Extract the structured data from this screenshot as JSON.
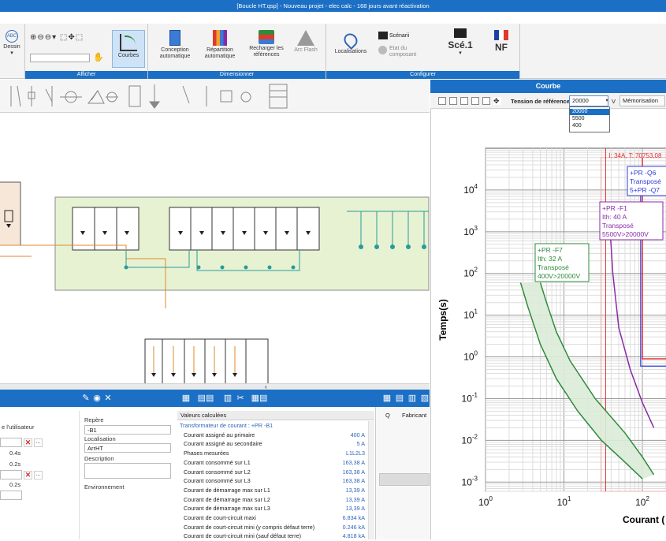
{
  "window": {
    "title": "[Boucle HT.qsp] - Nouveau projet - elec calc - 168 jours avant réactivation"
  },
  "ribbon": {
    "dessin_label": "Dessin",
    "afficher_label": "Afficher",
    "courbes_label": "Courbes",
    "conception_label": "Conception automatique",
    "repartition_label": "Répartition automatique",
    "recharger_label": "Recharger les références",
    "arcflash_label": "Arc Flash",
    "dimensionner_label": "Dimensionner",
    "localisations_label": "Localisations",
    "scenarii_label": "Scénarii",
    "etat_label": "Etat du composant",
    "scenario_value": "Scé.1",
    "norm_value": "NF",
    "configurer_label": "Configurer"
  },
  "properties": {
    "user_label": "e l'utilisateur",
    "val1": "0.4s",
    "val2": "0.2s",
    "val3": "0.2s",
    "repere_label": "Repère",
    "repere_value": "-B1",
    "localisation_label": "Localisation",
    "localisation_value": "ArrHT",
    "description_label": "Description",
    "environnement_label": "Environnement"
  },
  "values": {
    "header": "Valeurs calculées",
    "section": "Transformateur de courant : +PR -B1",
    "rows": [
      {
        "k": "Courant assigné au primaire",
        "v": "400 A"
      },
      {
        "k": "Courant assigné au secondaire",
        "v": "5 A"
      },
      {
        "k": "Phases mesurées",
        "v": "L1L2L3"
      },
      {
        "k": "Courant consommé sur L1",
        "v": "163,38 A"
      },
      {
        "k": "Courant consommé sur L2",
        "v": "163,38 A"
      },
      {
        "k": "Courant consommé sur L3",
        "v": "163,38 A"
      },
      {
        "k": "Courant de démarrage max sur L1",
        "v": "13,39 A"
      },
      {
        "k": "Courant de démarrage max sur L2",
        "v": "13,39 A"
      },
      {
        "k": "Courant de démarrage max sur L3",
        "v": "13,39 A"
      },
      {
        "k": "Courant de court-circuit maxi",
        "v": "6.834 kA"
      },
      {
        "k": "Courant de court-circuit mini (y compris défaut terre)",
        "v": "0.246 kA"
      },
      {
        "k": "Courant de court-circuit mini (sauf défaut terre)",
        "v": "4.818 kA"
      }
    ]
  },
  "rightbottom": {
    "col_q": "Q",
    "col_fab": "Fabricant"
  },
  "curve": {
    "title": "Courbe",
    "ref_label": "Tension de référence",
    "ref_value": "20000",
    "ref_unit": "V",
    "memorisation": "Mémorisation",
    "options": [
      "20000",
      "5500",
      "400"
    ],
    "cursor_label": "I: 34A, T: 70753,08",
    "ylabel": "Temps(s)",
    "xlabel": "Courant (",
    "annotations": {
      "q6": [
        "+PR -Q6",
        "Transposé",
        "5+PR -Q7"
      ],
      "f1": [
        "+PR -F1",
        "Ith: 40 A",
        "Transposé",
        "5500V>20000V"
      ],
      "f7": [
        "+PR -F7",
        "Ith: 32 A",
        "Transposé",
        "400V>20000V"
      ]
    }
  },
  "chart_data": {
    "type": "line",
    "title": "",
    "xlabel": "Courant (",
    "ylabel": "Temps(s)",
    "xscale": "log",
    "yscale": "log",
    "xlim": [
      1,
      200
    ],
    "ylim": [
      0.0006,
      100000
    ],
    "x_ticks": [
      "10^0",
      "10^1",
      "10^2"
    ],
    "y_ticks": [
      "10^-3",
      "10^-2",
      "10^-1",
      "10^0",
      "10^1",
      "10^2",
      "10^3",
      "10^4"
    ],
    "grid": true,
    "colors": {
      "f7": "#2e8b3a",
      "f1": "#8a2aa8",
      "q6": "#2d3dd8",
      "red": "#e03030",
      "cursor": "#e03030"
    },
    "series": [
      {
        "name": "+PR -F7",
        "x": [
          2.8,
          3.5,
          5,
          8,
          15,
          30,
          60,
          100
        ],
        "y": [
          60,
          15,
          2,
          0.3,
          0.05,
          0.01,
          0.003,
          0.0012
        ]
      },
      {
        "name": "+PR -F7",
        "x": [
          5,
          6,
          8,
          12,
          25,
          60,
          100,
          140
        ],
        "y": [
          60,
          20,
          4,
          0.8,
          0.1,
          0.015,
          0.004,
          0.0015
        ]
      },
      {
        "name": "+PR -F1",
        "x": [
          38,
          42,
          50,
          70,
          100,
          140
        ],
        "y": [
          2000,
          100,
          5,
          0.5,
          0.08,
          0.02
        ]
      }
    ],
    "cursor_x": 34
  }
}
